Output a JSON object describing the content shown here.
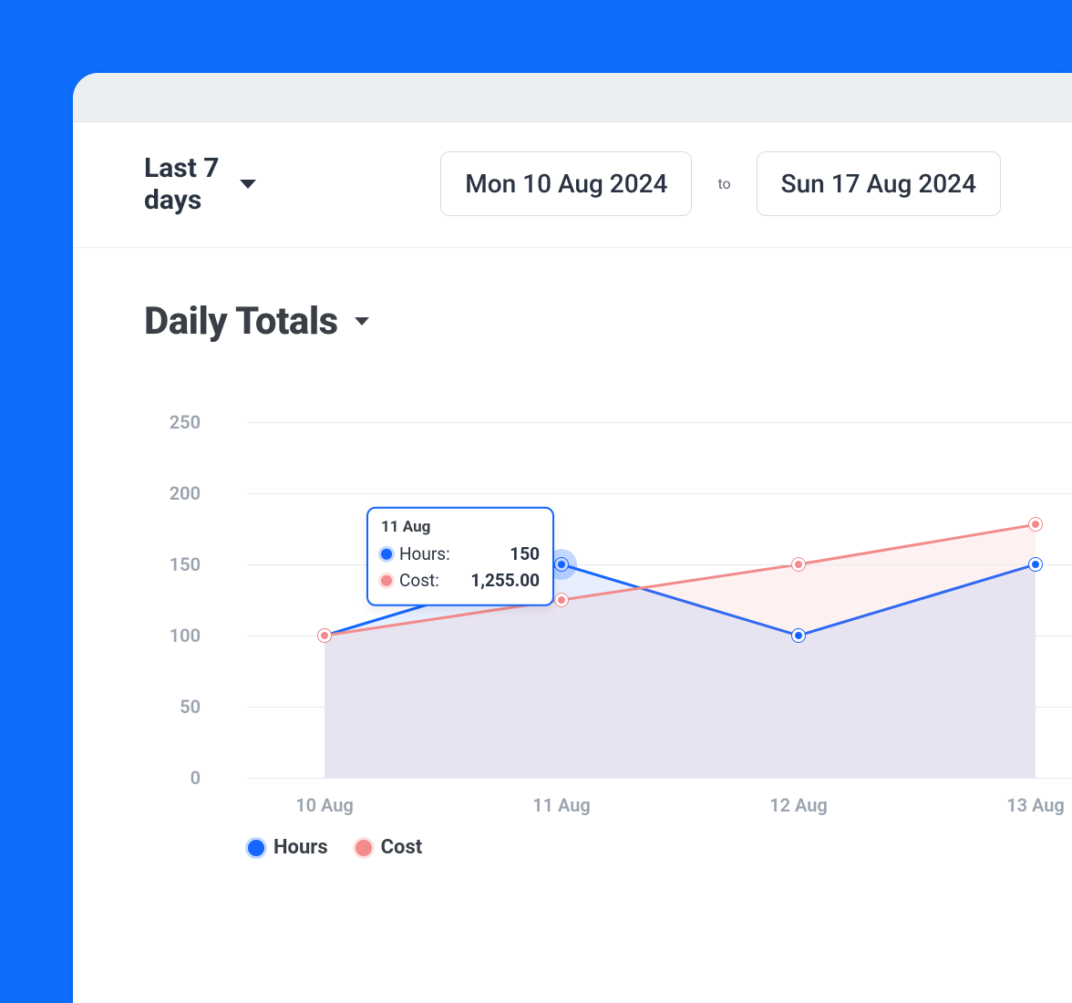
{
  "header": {
    "range_label": "Last 7 days",
    "date_from": "Mon 10 Aug 2024",
    "to_label": "to",
    "date_to": "Sun 17 Aug 2024"
  },
  "section": {
    "title": "Daily Totals"
  },
  "tooltip": {
    "title": "11 Aug",
    "rows": [
      {
        "label": "Hours:",
        "value": "150"
      },
      {
        "label": "Cost:",
        "value": "1,255.00"
      }
    ]
  },
  "legend": {
    "hours": "Hours",
    "cost": "Cost"
  },
  "chart_data": {
    "type": "line",
    "title": "Daily Totals",
    "x": [
      "10 Aug",
      "11 Aug",
      "12 Aug",
      "13 Aug"
    ],
    "series": [
      {
        "name": "Hours",
        "color": "#1565ff",
        "values": [
          100,
          150,
          100,
          150
        ]
      },
      {
        "name": "Cost",
        "color": "#f28b8b",
        "values": [
          100,
          125,
          150,
          178
        ]
      }
    ],
    "y_ticks": [
      0,
      50,
      100,
      150,
      200,
      250
    ],
    "ylim": [
      0,
      250
    ],
    "xlabel": "",
    "ylabel": "",
    "highlight_index": 1,
    "tooltip_detail": {
      "11 Aug": {
        "Hours": 150,
        "Cost": 1255.0
      }
    }
  },
  "colors": {
    "hours": "#1565ff",
    "cost": "#f28b8b",
    "accent": "#0d6efd"
  }
}
